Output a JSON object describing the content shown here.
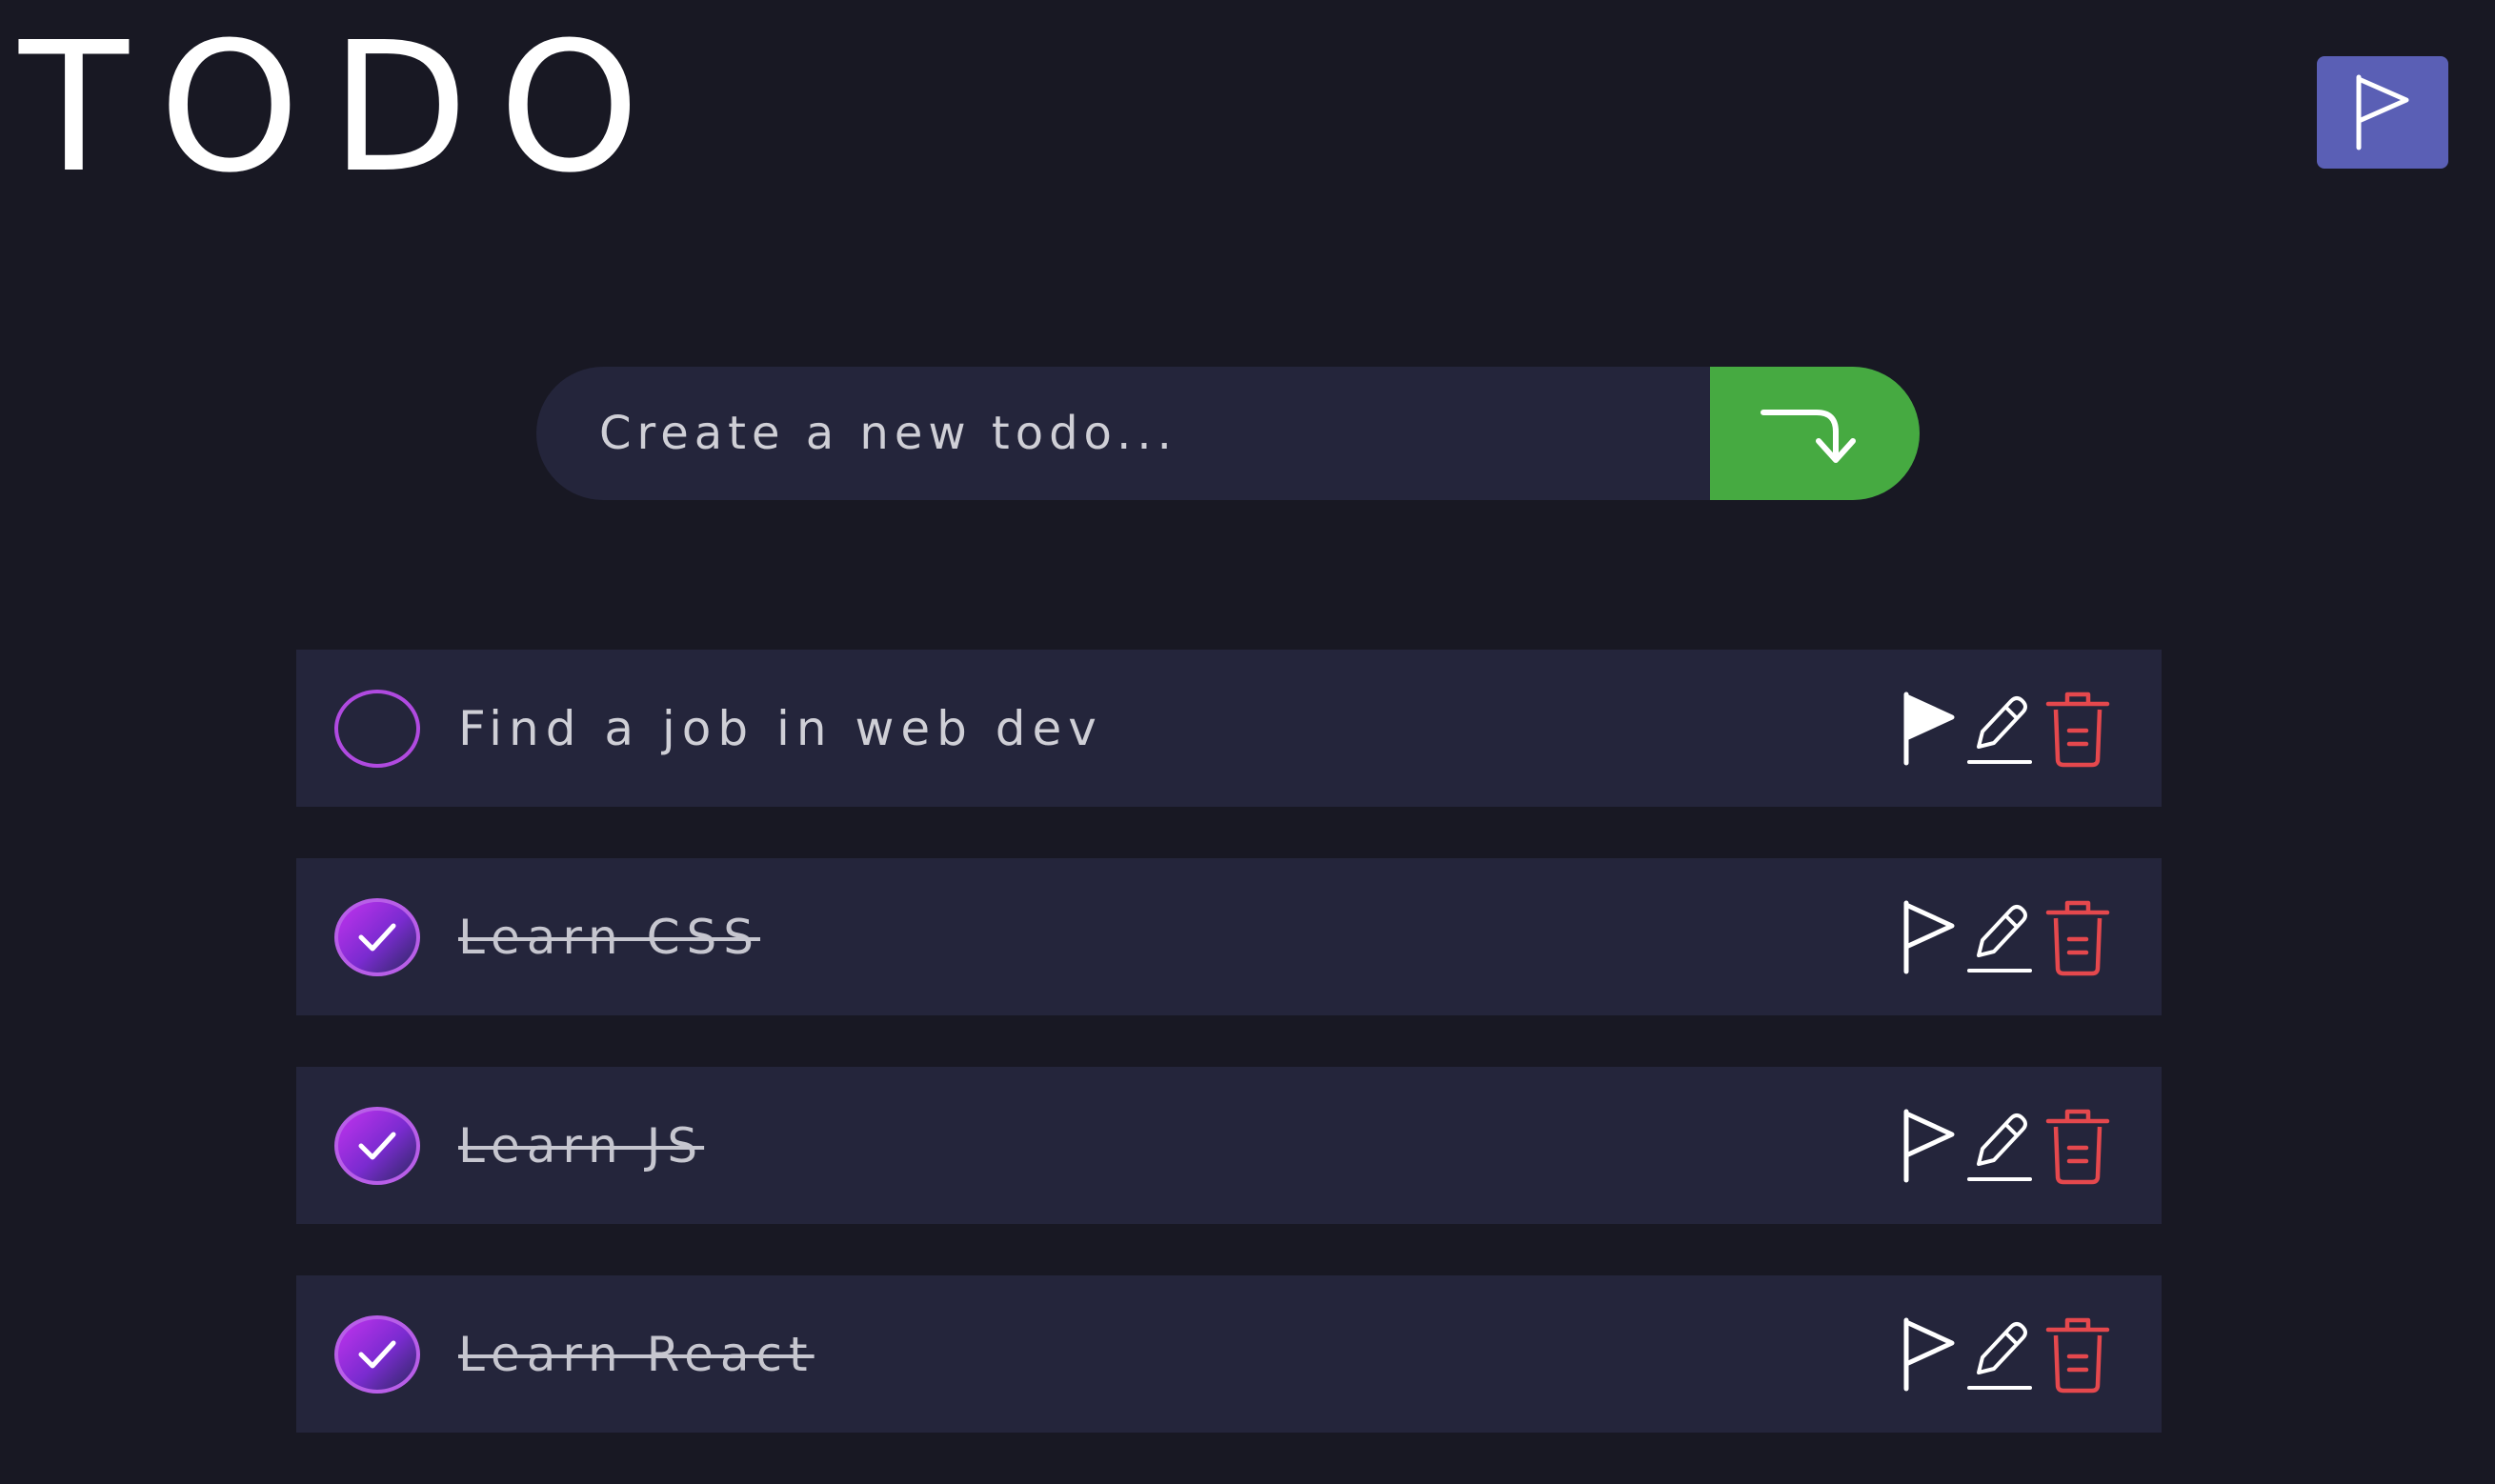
{
  "app": {
    "title": "TODO"
  },
  "header": {
    "flag_filter_icon": "flag-outline-icon",
    "flag_filter_color": "#5a5fb5"
  },
  "new_todo": {
    "placeholder": "Create a new todo...",
    "submit_icon": "arrow-turn-down-icon",
    "submit_color": "#46aa41"
  },
  "todos": [
    {
      "text": "Find a job in web dev",
      "completed": false,
      "flagged": true
    },
    {
      "text": "Learn CSS",
      "completed": true,
      "flagged": false
    },
    {
      "text": "Learn JS",
      "completed": true,
      "flagged": false
    },
    {
      "text": "Learn React",
      "completed": true,
      "flagged": false
    }
  ],
  "colors": {
    "background": "#181823",
    "card": "#24253b",
    "checkbox_accent": "#b04ae0",
    "delete_icon": "#e5484d"
  }
}
